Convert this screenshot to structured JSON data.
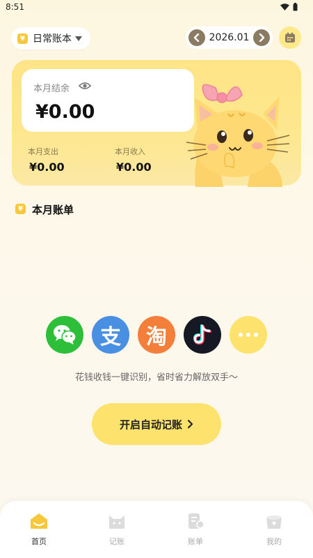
{
  "status_bar": {
    "time": "8:51"
  },
  "header": {
    "book_badge": "¥",
    "book_name": "日常账本",
    "month": "2026.01",
    "prev_icon": "chevron-left-icon",
    "next_icon": "chevron-right-icon",
    "calendar_icon": "calendar-icon"
  },
  "summary": {
    "balance_label": "本月结余",
    "balance_value": "¥0.00",
    "expense_label": "本月支出",
    "expense_value": "¥0.00",
    "income_label": "本月收入",
    "income_value": "¥0.00"
  },
  "bills": {
    "badge": "¥",
    "title": "本月账单"
  },
  "auto_record": {
    "apps": [
      {
        "name": "wechat-icon",
        "color": "#2dbf3a"
      },
      {
        "name": "alipay-icon",
        "color": "#4a90e2",
        "glyph": "支"
      },
      {
        "name": "taobao-icon",
        "color": "#f47f3a",
        "glyph": "淘"
      },
      {
        "name": "douyin-icon",
        "color": "#161823"
      },
      {
        "name": "more-icon",
        "color": "#fde36e"
      }
    ],
    "hint": "花钱收钱一键识别，省时省力解放双手～",
    "button_label": "开启自动记账"
  },
  "bottom_nav": [
    {
      "label": "首页",
      "active": true
    },
    {
      "label": "记账",
      "active": false
    },
    {
      "label": "账单",
      "active": false
    },
    {
      "label": "我的",
      "active": false
    }
  ],
  "colors": {
    "accent": "#fde36e",
    "brand_yellow": "#f6c83a",
    "nav_button": "#8b7b63"
  }
}
